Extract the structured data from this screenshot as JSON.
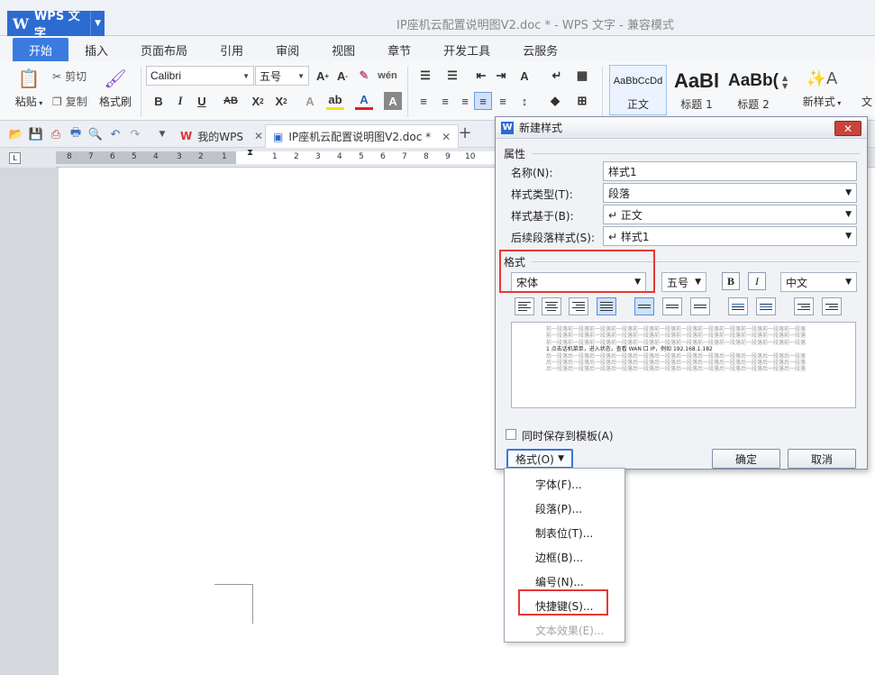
{
  "app": {
    "button_label": "WPS 文字",
    "doc_title": "IP座机云配置说明图V2.doc * - WPS 文字 - 兼容模式"
  },
  "menu_tabs": [
    "开始",
    "插入",
    "页面布局",
    "引用",
    "审阅",
    "视图",
    "章节",
    "开发工具",
    "云服务"
  ],
  "ribbon": {
    "paste": "粘贴",
    "cut": "剪切",
    "copy": "复制",
    "format_painter": "格式刷",
    "font_name": "Calibri",
    "font_size": "五号",
    "styles": [
      {
        "sample": "AaBbCcDd",
        "name": "正文"
      },
      {
        "sample": "AaBl",
        "name": "标题 1"
      },
      {
        "sample": "AaBb(",
        "name": "标题 2"
      }
    ],
    "new_style": "新样式",
    "text_cut": "文"
  },
  "doc_tabs": {
    "my_wps": "我的WPS",
    "current_doc": "IP座机云配置说明图V2.doc *",
    "add": "+"
  },
  "ruler": {
    "numbers": [
      "8",
      "7",
      "6",
      "5",
      "4",
      "3",
      "2",
      "1",
      "",
      "1",
      "2",
      "3",
      "4",
      "5",
      "6",
      "7",
      "8",
      "9",
      "10"
    ]
  },
  "dialog": {
    "title": "新建样式",
    "close": "✕",
    "section_props": "属性",
    "name_label": "名称(N):",
    "name_value": "样式1",
    "type_label": "样式类型(T):",
    "type_value": "段落",
    "based_label": "样式基于(B):",
    "based_value": "↵ 正文",
    "next_label": "后续段落样式(S):",
    "next_value": "↵ 样式1",
    "section_format": "格式",
    "font_value": "宋体",
    "size_value": "五号",
    "bold": "B",
    "italic": "I",
    "lang_value": "中文",
    "preview_lines": [
      "前一段落前一段落前一段落前一段落前一段落前一段落前一段落前一段落前一段落前一段落前一段落前一段落",
      "前一段落前一段落前一段落前一段落前一段落前一段落前一段落前一段落前一段落前一段落前一段落前一段落",
      "前一段落前一段落前一段落前一段落前一段落前一段落前一段落前一段落前一段落前一段落前一段落前一段落",
      "1 点击话机菜单，进入状态，查看 WAN 口 IP，例如 192.168.1.182",
      "后一段落后一段落后一段落后一段落后一段落后一段落后一段落后一段落后一段落后一段落后一段落后一段落",
      "后一段落后一段落后一段落后一段落后一段落后一段落后一段落后一段落后一段落后一段落后一段落后一段落",
      "后一段落后一段落后一段落后一段落后一段落后一段落后一段落后一段落后一段落后一段落后一段落后一段落"
    ],
    "save_template": "同时保存到模板(A)",
    "format_btn": "格式(O)",
    "ok": "确定",
    "cancel": "取消"
  },
  "popup_menu": {
    "items": [
      "字体(F)...",
      "段落(P)...",
      "制表位(T)...",
      "边框(B)...",
      "编号(N)...",
      "快捷键(S)...",
      "文本效果(E)..."
    ]
  }
}
